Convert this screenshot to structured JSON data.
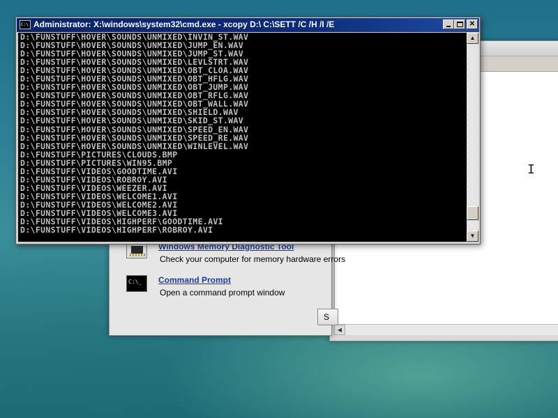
{
  "cmd_window": {
    "title": "Administrator: X:\\windows\\system32\\cmd.exe - xcopy  D:\\ C:\\SETT /C /H /I /E",
    "icon": "cmd-icon",
    "app_icon_text": "C:\\",
    "controls": {
      "minimize_icon": "minimize-icon",
      "maximize_icon": "maximize-icon",
      "close_icon": "close-icon",
      "close_glyph": "✕"
    },
    "console_lines": [
      "D:\\FUNSTUFF\\HOVER\\SOUNDS\\UNMIXED\\INVIN_ST.WAV",
      "D:\\FUNSTUFF\\HOVER\\SOUNDS\\UNMIXED\\JUMP_EN.WAV",
      "D:\\FUNSTUFF\\HOVER\\SOUNDS\\UNMIXED\\JUMP_ST.WAV",
      "D:\\FUNSTUFF\\HOVER\\SOUNDS\\UNMIXED\\LEVLSTRT.WAV",
      "D:\\FUNSTUFF\\HOVER\\SOUNDS\\UNMIXED\\OBT_CLOA.WAV",
      "D:\\FUNSTUFF\\HOVER\\SOUNDS\\UNMIXED\\OBT_HFLG.WAV",
      "D:\\FUNSTUFF\\HOVER\\SOUNDS\\UNMIXED\\OBT_JUMP.WAV",
      "D:\\FUNSTUFF\\HOVER\\SOUNDS\\UNMIXED\\OBT_RFLG.WAV",
      "D:\\FUNSTUFF\\HOVER\\SOUNDS\\UNMIXED\\OBT_WALL.WAV",
      "D:\\FUNSTUFF\\HOVER\\SOUNDS\\UNMIXED\\SHIELD.WAV",
      "D:\\FUNSTUFF\\HOVER\\SOUNDS\\UNMIXED\\SKID_ST.WAV",
      "D:\\FUNSTUFF\\HOVER\\SOUNDS\\UNMIXED\\SPEED_EN.WAV",
      "D:\\FUNSTUFF\\HOVER\\SOUNDS\\UNMIXED\\SPEED_RE.WAV",
      "D:\\FUNSTUFF\\HOVER\\SOUNDS\\UNMIXED\\WINLEVEL.WAV",
      "D:\\FUNSTUFF\\PICTURES\\CLOUDS.BMP",
      "D:\\FUNSTUFF\\PICTURES\\WIN95.BMP",
      "D:\\FUNSTUFF\\VIDEOS\\GOODTIME.AVI",
      "D:\\FUNSTUFF\\VIDEOS\\ROBROY.AVI",
      "D:\\FUNSTUFF\\VIDEOS\\WEEZER.AVI",
      "D:\\FUNSTUFF\\VIDEOS\\WELCOME1.AVI",
      "D:\\FUNSTUFF\\VIDEOS\\WELCOME2.AVI",
      "D:\\FUNSTUFF\\VIDEOS\\WELCOME3.AVI",
      "D:\\FUNSTUFF\\VIDEOS\\HIGHPERF\\GOODTIME.AVI",
      "D:\\FUNSTUFF\\VIDEOS\\HIGHPERF\\ROBROY.AVI"
    ],
    "scrollbar": {
      "up_icon": "scroll-up-arrow-icon",
      "down_icon": "scroll-down-arrow-icon",
      "up_glyph": "▲",
      "down_glyph": "▼",
      "position": 0.94
    }
  },
  "recovery_window": {
    "items": [
      {
        "icon": "memory-chip-icon",
        "title": "Windows Memory Diagnostic Tool",
        "description": "Check your computer for memory hardware errors"
      },
      {
        "icon": "command-prompt-icon",
        "icon_text": "C:\\_",
        "title": "Command Prompt",
        "description": "Open a command prompt window"
      }
    ],
    "button_label": "S"
  },
  "background_window": {
    "cursor_icon": "text-cursor-icon",
    "cursor_glyph": "I",
    "scroll_left_glyph": "◀"
  },
  "colors": {
    "console_bg": "#000000",
    "console_text": "#c0c0c0",
    "titlebar": "#0a246a",
    "link": "#1b3d9c"
  }
}
